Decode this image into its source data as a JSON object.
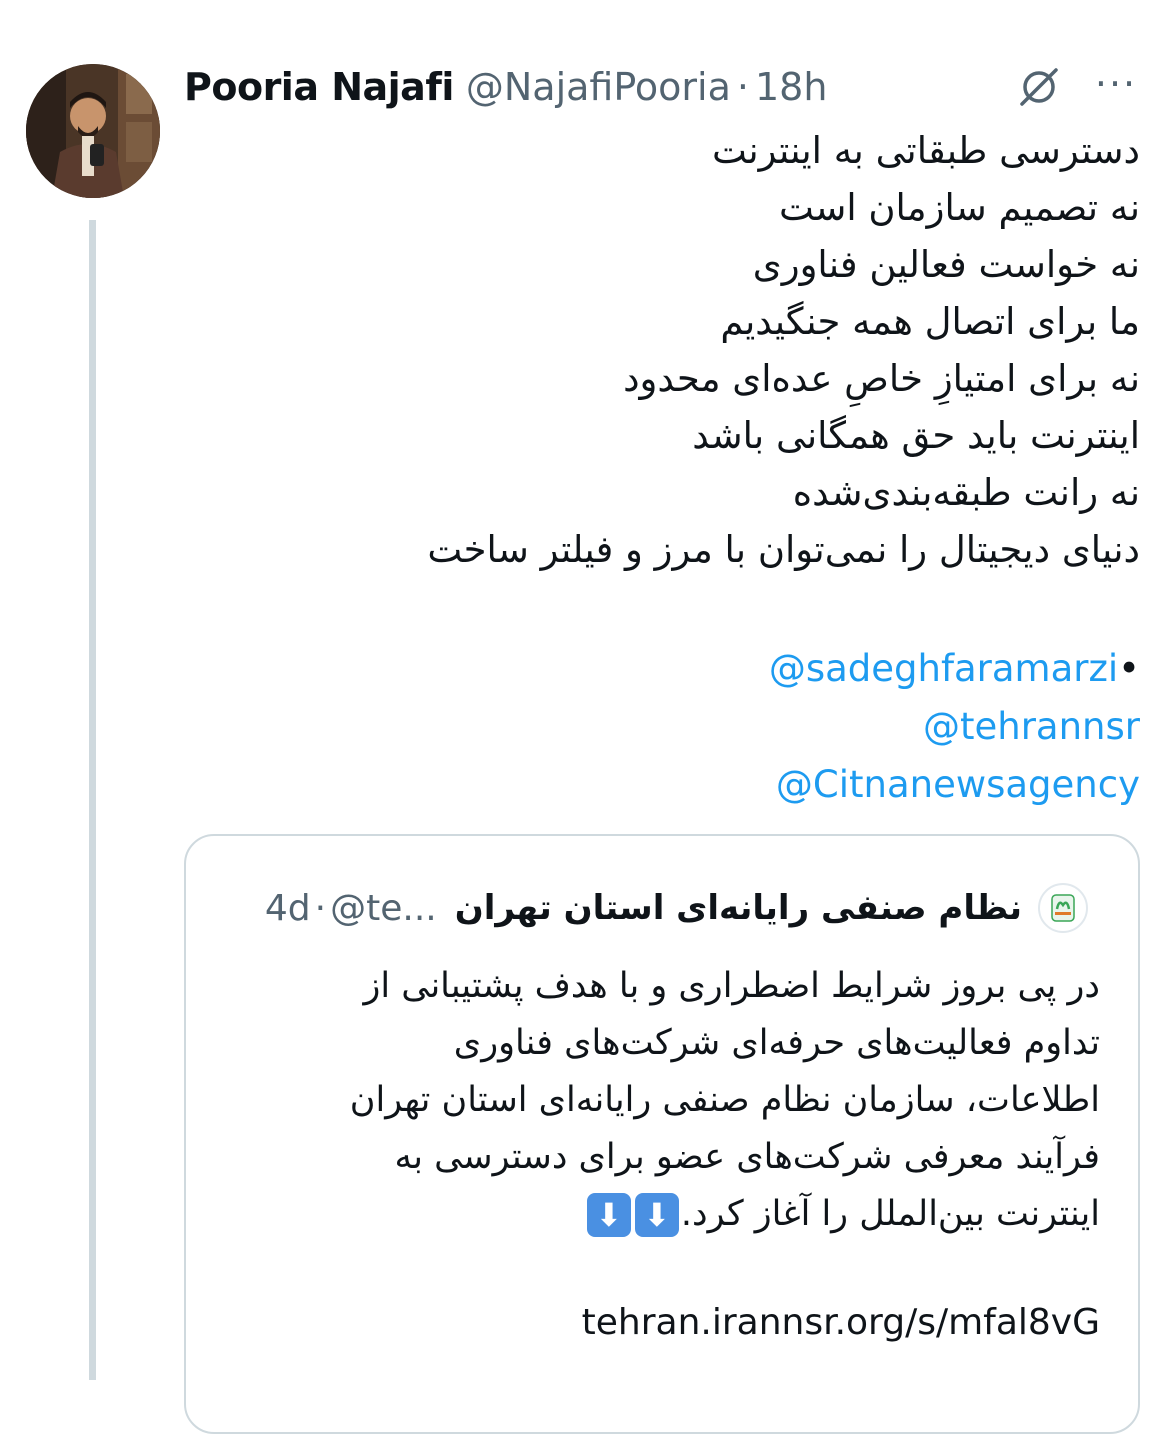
{
  "author": {
    "name": "Pooria Najafi",
    "handle": "@NajafiPooria",
    "separator": "·",
    "time": "18h"
  },
  "tweet": {
    "lines": [
      "دسترسی طبقاتی به اینترنت",
      "نه تصمیم سازمان است",
      "نه خواست فعالین فناوری",
      "ما برای اتصال همه جنگیدیم",
      "نه برای امتیازِ خاصِ عده‌ای محدود",
      "اینترنت باید حق همگانی باشد",
      "نه رانت طبقه‌بندی‌شده",
      "دنیای دیجیتال را نمی‌توان با مرز و فیلتر ساخت"
    ],
    "bullet": "•",
    "mentions": [
      "@sadeghfaramarzi",
      "@tehrannsr",
      "@Citnanewsagency"
    ]
  },
  "quoted": {
    "name": "نظام صنفی رایانه‌ای استان تهران",
    "handle": "@te...",
    "separator": "·",
    "time": "4d",
    "lines": [
      "در پی بروز شرایط اضطراری و با هدف پشتیبانی از",
      "تداوم فعالیت‌های حرفه‌ای شرکت‌های فناوری",
      "اطلاعات، سازمان نظام صنفی رایانه‌ای استان تهران",
      "فرآیند معرفی شرکت‌های عضو برای دسترسی به"
    ],
    "last_line": "اینترنت بین‌الملل را آغاز کرد.",
    "emoji": [
      "⬇",
      "⬇"
    ],
    "link": "tehran.irannsr.org/s/mfal8vG"
  },
  "icons": {
    "grok": "grok-icon",
    "more": "more-options-icon"
  },
  "colors": {
    "text": "#0f1419",
    "secondary": "#536471",
    "link": "#1d9bf0",
    "border": "#cfd9de",
    "emoji_arrow": "#4a90e2"
  }
}
